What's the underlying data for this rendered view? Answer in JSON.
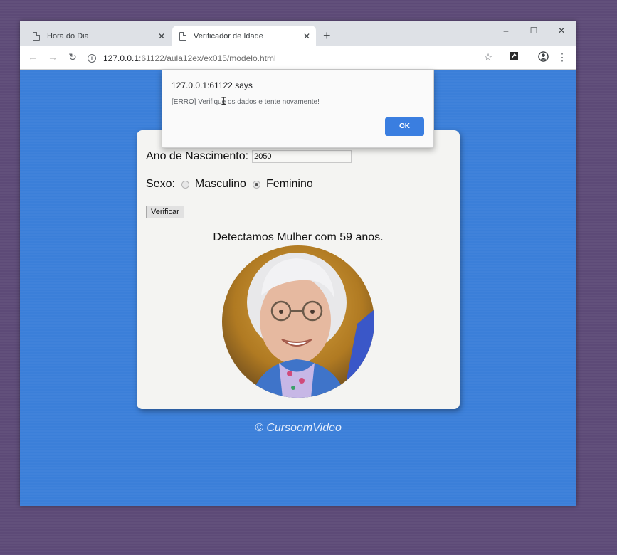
{
  "browser": {
    "tabs": [
      {
        "title": "Hora do Dia",
        "active": false
      },
      {
        "title": "Verificador de Idade",
        "active": true
      }
    ],
    "url_host": "127.0.0.1",
    "url_rest": ":61122/aula12ex/ex015/modelo.html",
    "window_controls": {
      "minimize": "–",
      "maximize": "☐",
      "close": "✕"
    }
  },
  "alert": {
    "origin": "127.0.0.1:61122 says",
    "message": "[ERRO] Verifique os dados e tente novamente!",
    "ok_label": "OK"
  },
  "form": {
    "ano_label": "Ano de Nascimento:",
    "ano_value": "2050",
    "sexo_label": "Sexo:",
    "options": [
      {
        "label": "Masculino",
        "checked": false
      },
      {
        "label": "Feminino",
        "checked": true
      }
    ],
    "button_label": "Verificar"
  },
  "result": {
    "text": "Detectamos Mulher com 59 anos."
  },
  "footer": "© CursoemVideo",
  "colors": {
    "page_bg": "#3b7fd9",
    "card_bg": "#f4f4f2",
    "ok_button": "#3a7ee0",
    "outer_bg": "#5d4a77"
  }
}
